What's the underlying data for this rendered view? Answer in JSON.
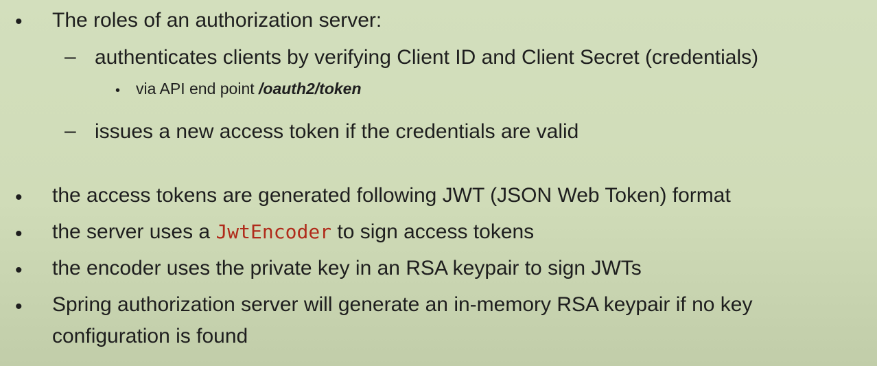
{
  "slide": {
    "item1": {
      "text": "The roles of an authorization server:",
      "subitems": [
        {
          "text": "authenticates clients by verifying Client ID and Client Secret (credentials)",
          "detail_prefix": "via API end point ",
          "detail_endpoint": "/oauth2/token"
        },
        {
          "text": "issues a new access token if the credentials are valid"
        }
      ]
    },
    "item2": {
      "text": "the access tokens are generated following JWT (JSON Web Token) format"
    },
    "item3": {
      "prefix": "the server uses a ",
      "code": "JwtEncoder",
      "suffix": " to sign access tokens"
    },
    "item4": {
      "text": "the encoder uses the private key in an RSA keypair to sign JWTs"
    },
    "item5": {
      "line1": "Spring authorization server will generate an in-memory RSA keypair if no key",
      "line2": "configuration is found"
    }
  }
}
